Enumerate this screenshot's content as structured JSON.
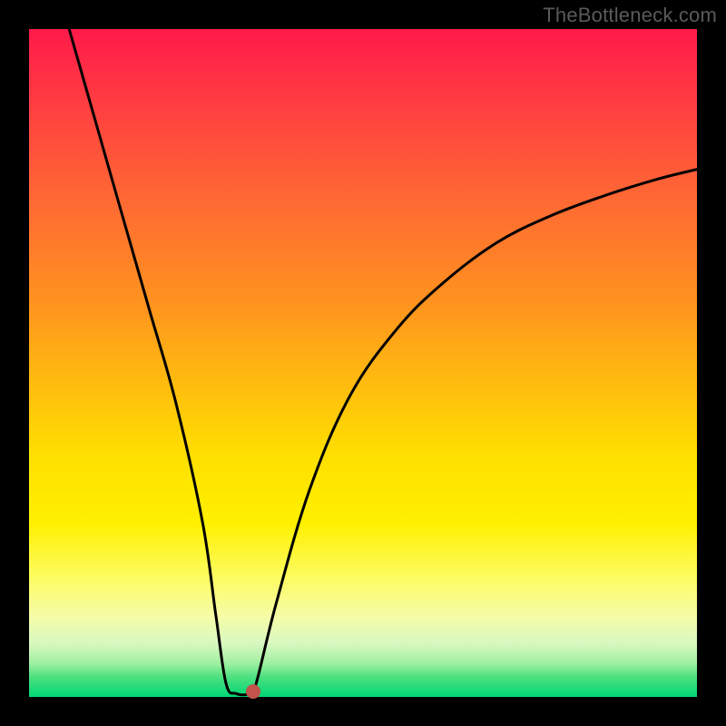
{
  "watermark": "TheBottleneck.com",
  "chart_data": {
    "type": "line",
    "title": "",
    "xlabel": "",
    "ylabel": "",
    "xlim": [
      0,
      100
    ],
    "ylim": [
      0,
      100
    ],
    "grid": false,
    "legend": false,
    "series": [
      {
        "name": "curve",
        "x": [
          6,
          10,
          14,
          18,
          22,
          26,
          28,
          29.5,
          31,
          33,
          34,
          37,
          42,
          48,
          55,
          62,
          70,
          78,
          86,
          94,
          100
        ],
        "values": [
          100,
          86,
          72,
          58,
          44,
          26,
          12,
          2,
          0.5,
          0.5,
          2,
          14,
          31,
          45,
          55,
          62,
          68,
          72,
          75,
          77.5,
          79
        ]
      }
    ],
    "marker": {
      "x": 33.5,
      "y": 0.8,
      "color": "#c0534a"
    },
    "background": "rainbow-vertical-gradient"
  }
}
